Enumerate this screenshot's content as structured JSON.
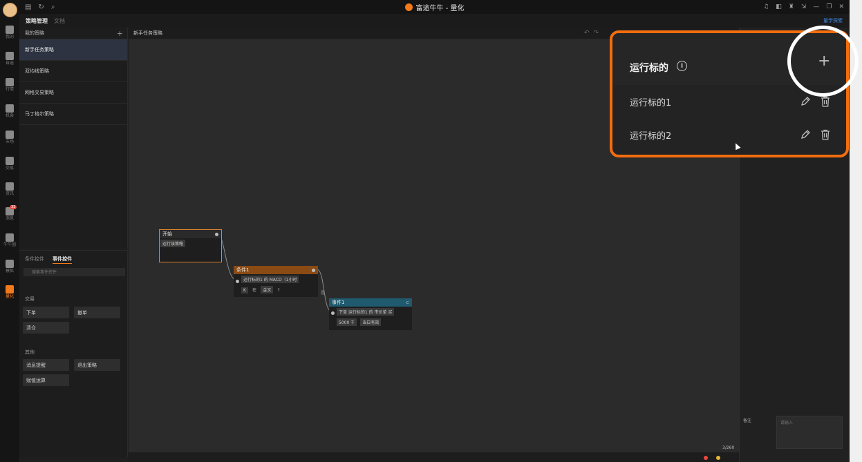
{
  "window": {
    "title": "富途牛牛 - 量化",
    "logo_icon": "futu-logo-icon"
  },
  "leftnav": {
    "items": [
      {
        "label": "我的",
        "icon": "person-icon"
      },
      {
        "label": "自选",
        "icon": "bar-chart-icon"
      },
      {
        "label": "行情",
        "icon": "trend-icon"
      },
      {
        "label": "机会",
        "icon": "filter-icon"
      },
      {
        "label": "市场",
        "icon": "pie-icon"
      },
      {
        "label": "交易",
        "icon": "trade-icon"
      },
      {
        "label": "资讯",
        "icon": "news-icon"
      },
      {
        "label": "消息",
        "icon": "chat-icon",
        "badge": "33"
      },
      {
        "label": "牛牛圈",
        "icon": "community-icon"
      },
      {
        "label": "模拟",
        "icon": "game-icon"
      },
      {
        "label": "量化",
        "icon": "code-icon",
        "active": true
      }
    ]
  },
  "tabs": [
    {
      "label": "策略管理",
      "active": true
    },
    {
      "label": "文档",
      "active": false
    }
  ],
  "tabs_right_link": "量学探索",
  "strategy_list": {
    "header": "我的策略",
    "add_icon": "plus-icon",
    "items": [
      {
        "label": "新手任务策略",
        "selected": true
      },
      {
        "label": "双均线策略",
        "selected": false
      },
      {
        "label": "网格交易策略",
        "selected": false
      },
      {
        "label": "马丁格尔策略",
        "selected": false
      }
    ]
  },
  "widgets": {
    "tabs": [
      {
        "label": "条件控件",
        "active": false
      },
      {
        "label": "事件控件",
        "active": true
      }
    ],
    "search_placeholder": "搜索事件控件",
    "groups": [
      {
        "title": "交易",
        "buttons": [
          "下单",
          "撤单",
          "清仓"
        ]
      },
      {
        "title": "其他",
        "buttons": [
          "消息提醒",
          "退出策略",
          "赋值运算"
        ]
      }
    ]
  },
  "canvas": {
    "title": "新手任务策略",
    "counter": "3/260",
    "nodes": {
      "start": {
        "title": "开始",
        "chip": "运行该策略"
      },
      "condition": {
        "title": "条件1",
        "line1": "运行标的1 的 MACD（1小时",
        "chip_a": "K",
        "text_b": "在",
        "chip_c": "金叉",
        "text_d": "?"
      },
      "edge_label": "是",
      "event": {
        "title": "事件1",
        "line1": "下单 运行标的1 的 市价单 买",
        "chip_a": "5000 千",
        "chip_b": "当日有效"
      }
    }
  },
  "props": {
    "remark_label": "备注",
    "remark_placeholder": "请输入"
  },
  "zoom_popup": {
    "title": "运行标的",
    "info_icon": "info-icon",
    "add_icon": "plus-icon",
    "items": [
      {
        "label": "运行标的1",
        "edit_icon": "pencil-icon",
        "delete_icon": "trash-icon"
      },
      {
        "label": "运行标的2",
        "edit_icon": "pencil-icon",
        "delete_icon": "trash-icon"
      }
    ]
  },
  "colors": {
    "accent": "#f27a1a",
    "highlight_border": "#f26d0f",
    "start_node": "#e3862b",
    "condition_node": "#8a4a14",
    "event_node": "#1f5a6e",
    "link": "#3f8be6"
  }
}
